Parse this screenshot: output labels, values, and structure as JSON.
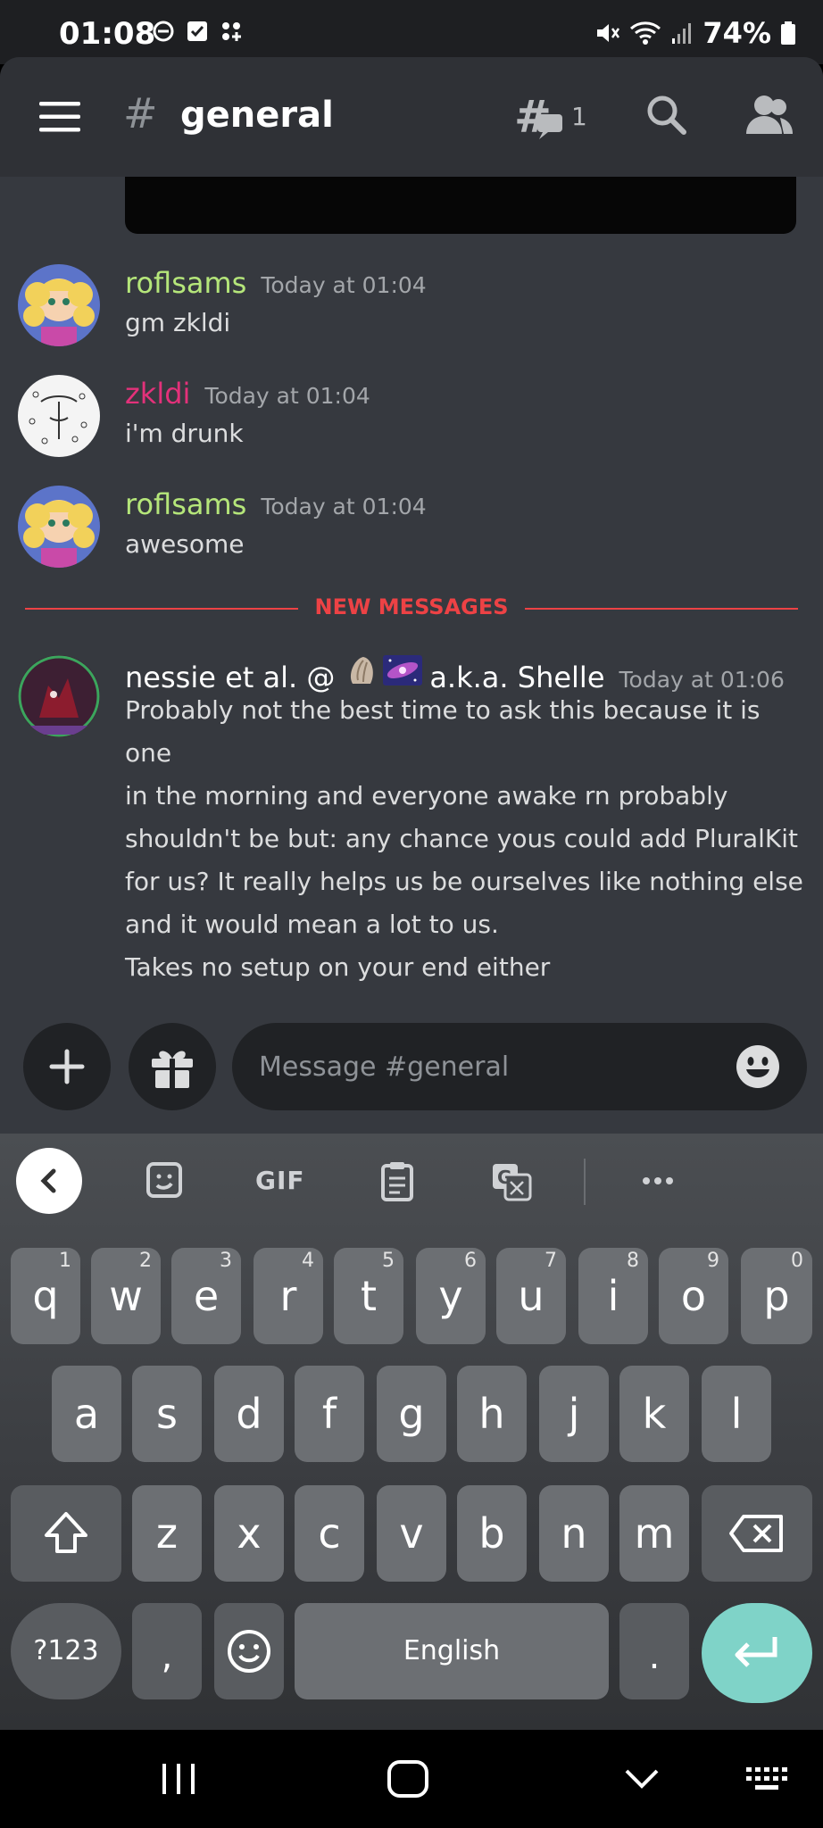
{
  "status_bar": {
    "time": "01:08",
    "battery": "74%",
    "icons_left": [
      "dnd-icon",
      "check-square-icon",
      "apps-icon"
    ],
    "icons_right": [
      "mute-icon",
      "wifi-icon",
      "signal-icon",
      "battery-icon"
    ]
  },
  "header": {
    "channel_hash": "#",
    "channel_name": "general",
    "threads_count": "1"
  },
  "messages": [
    {
      "author": "roflsams",
      "author_color": "#b5e67a",
      "timestamp": "Today at 01:04",
      "text": "gm zkldi"
    },
    {
      "author": "zkldi",
      "author_color": "#e3317a",
      "timestamp": "Today at 01:04",
      "text": "i'm drunk"
    },
    {
      "author": "roflsams",
      "author_color": "#b5e67a",
      "timestamp": "Today at 01:04",
      "text": "awesome"
    }
  ],
  "divider": {
    "label": "NEW MESSAGES",
    "color": "#ed4245"
  },
  "new_message": {
    "author_prefix": "nessie et al. @",
    "author_suffix": "a.k.a. Shelle",
    "author_color": "#ffffff",
    "timestamp": "Today at 01:06",
    "text": "Probably not the best time to ask this because it is one\nin the morning and everyone awake rn probably\nshouldn't be but: any chance yous could add PluralKit\nfor us? It really helps us be ourselves like nothing else\nand it would mean a lot to us.\nTakes no setup on your end either"
  },
  "composer": {
    "placeholder": "Message #general"
  },
  "keyboard": {
    "toolbar_gif": "GIF",
    "row1": [
      {
        "k": "q",
        "h": "1"
      },
      {
        "k": "w",
        "h": "2"
      },
      {
        "k": "e",
        "h": "3"
      },
      {
        "k": "r",
        "h": "4"
      },
      {
        "k": "t",
        "h": "5"
      },
      {
        "k": "y",
        "h": "6"
      },
      {
        "k": "u",
        "h": "7"
      },
      {
        "k": "i",
        "h": "8"
      },
      {
        "k": "o",
        "h": "9"
      },
      {
        "k": "p",
        "h": "0"
      }
    ],
    "row2": [
      "a",
      "s",
      "d",
      "f",
      "g",
      "h",
      "j",
      "k",
      "l"
    ],
    "row3": [
      "z",
      "x",
      "c",
      "v",
      "b",
      "n",
      "m"
    ],
    "sym_label": "?123",
    "comma": ",",
    "space_label": "English",
    "period": ".",
    "enter_color": "#7fd3c8"
  }
}
